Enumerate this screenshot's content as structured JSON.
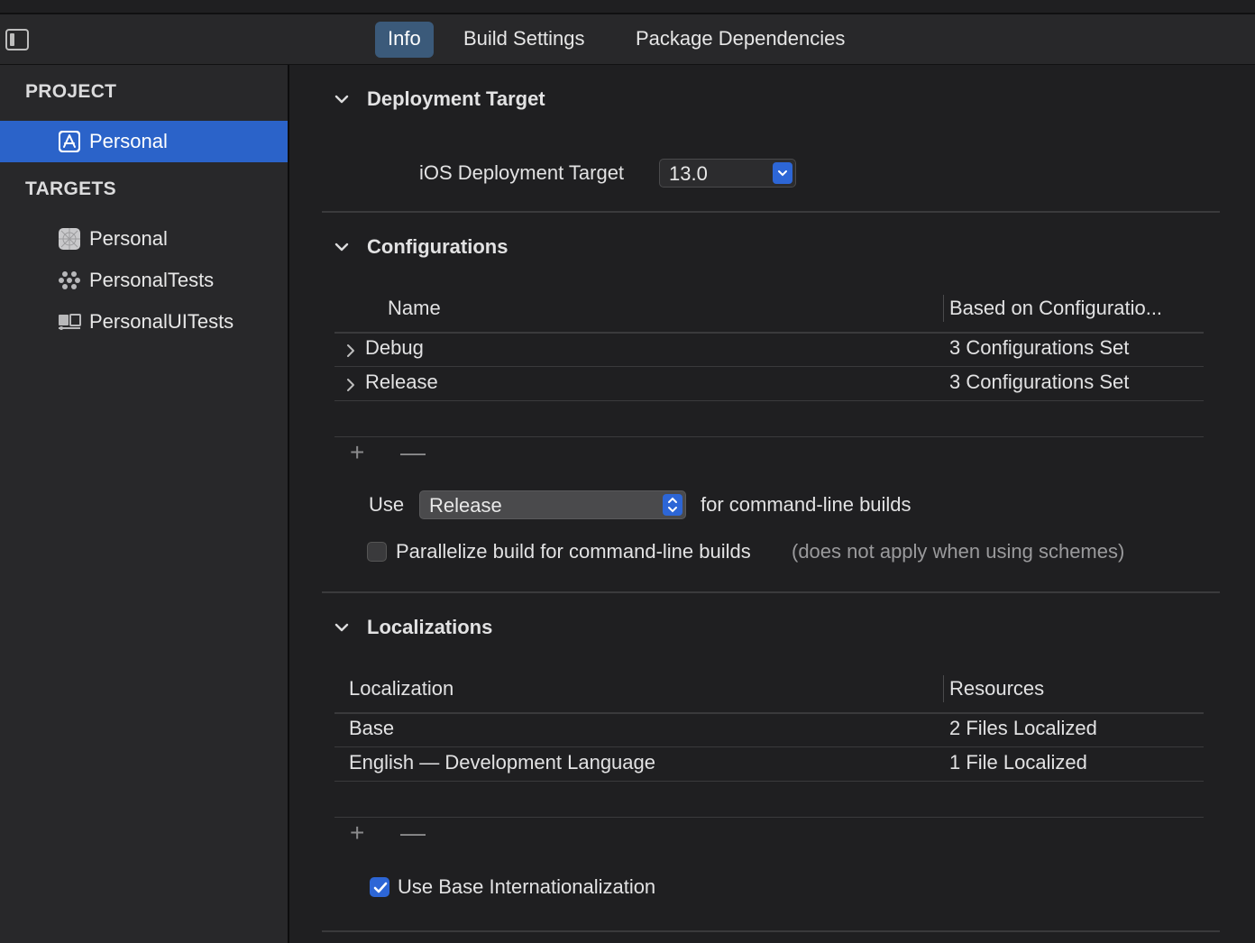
{
  "tabs": [
    {
      "label": "Info"
    },
    {
      "label": "Build Settings"
    },
    {
      "label": "Package Dependencies"
    }
  ],
  "sidebar": {
    "project_header": "PROJECT",
    "project_items": [
      {
        "label": "Personal",
        "icon": "app-store-icon"
      }
    ],
    "targets_header": "TARGETS",
    "target_items": [
      {
        "label": "Personal",
        "icon": "app-target-icon"
      },
      {
        "label": "PersonalTests",
        "icon": "test-bundle-icon"
      },
      {
        "label": "PersonalUITests",
        "icon": "ui-test-bundle-icon"
      }
    ]
  },
  "deployment": {
    "title": "Deployment Target",
    "ios_label": "iOS Deployment Target",
    "ios_value": "13.0"
  },
  "configurations": {
    "title": "Configurations",
    "col_name": "Name",
    "col_based": "Based on Configuratio...",
    "rows": [
      {
        "name": "Debug",
        "based": "3 Configurations Set"
      },
      {
        "name": "Release",
        "based": "3 Configurations Set"
      }
    ],
    "add": "+",
    "remove": "—",
    "use_label": "Use",
    "use_value": "Release",
    "use_suffix": "for command-line builds",
    "parallelize_label": "Parallelize build for command-line builds",
    "parallelize_note": "(does not apply when using schemes)"
  },
  "localizations": {
    "title": "Localizations",
    "col_loc": "Localization",
    "col_res": "Resources",
    "rows": [
      {
        "loc": "Base",
        "res": "2 Files Localized"
      },
      {
        "loc": "English — Development Language",
        "res": "1 File Localized"
      }
    ],
    "add": "+",
    "remove": "—",
    "base_intl_label": "Use Base Internationalization"
  },
  "colors": {
    "accent": "#2b63c9",
    "tab_active": "#3b5a7a"
  }
}
